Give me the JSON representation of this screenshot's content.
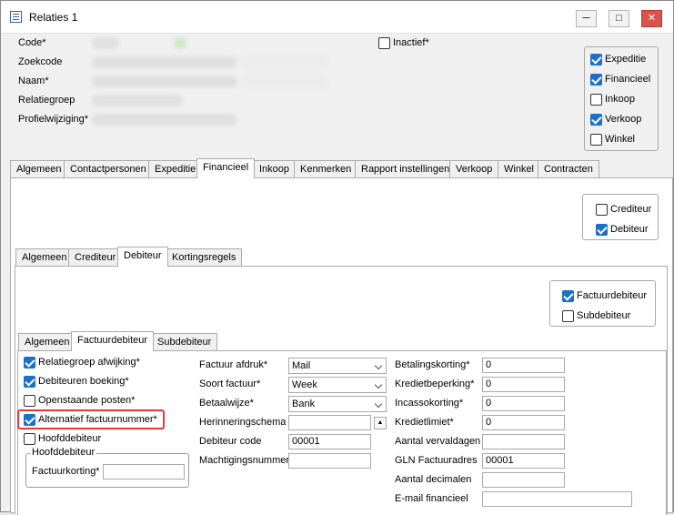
{
  "window": {
    "title": "Relaties 1",
    "minimize": "─",
    "maximize": "□",
    "close": "✕"
  },
  "header": {
    "code_label": "Code*",
    "zoekcode_label": "Zoekcode",
    "naam_label": "Naam*",
    "relatiegroep_label": "Relatiegroep",
    "profielwijziging_label": "Profielwijziging*",
    "inactief_label": "Inactief*",
    "inactief_checked": false
  },
  "roles": [
    {
      "label": "Expeditie",
      "checked": true
    },
    {
      "label": "Financieel",
      "checked": true
    },
    {
      "label": "Inkoop",
      "checked": false
    },
    {
      "label": "Verkoop",
      "checked": true
    },
    {
      "label": "Winkel",
      "checked": false
    }
  ],
  "main_tabs": [
    "Algemeen",
    "Contactpersonen",
    "Expeditie",
    "Financieel",
    "Inkoop",
    "Kenmerken",
    "Rapport instellingen",
    "Verkoop",
    "Winkel",
    "Contracten"
  ],
  "main_active": "Financieel",
  "fin_roles": [
    {
      "label": "Crediteur",
      "checked": false
    },
    {
      "label": "Debiteur",
      "checked": true
    }
  ],
  "fin_tabs": [
    "Algemeen",
    "Crediteur",
    "Debiteur",
    "Kortingsregels"
  ],
  "fin_active": "Debiteur",
  "deb_roles": [
    {
      "label": "Factuurdebiteur",
      "checked": true
    },
    {
      "label": "Subdebiteur",
      "checked": false
    }
  ],
  "deb_tabs": [
    "Algemeen",
    "Factuurdebiteur",
    "Subdebiteur"
  ],
  "deb_active": "Factuurdebiteur",
  "options": [
    {
      "label": "Relatiegroep afwijking*",
      "checked": true
    },
    {
      "label": "Debiteuren boeking*",
      "checked": true
    },
    {
      "label": "Openstaande posten*",
      "checked": false
    },
    {
      "label": "Alternatief factuurnummer*",
      "checked": true
    },
    {
      "label": "Hoofddebiteur",
      "checked": false
    }
  ],
  "hoofddebiteur_group": {
    "legend": "Hoofddebiteur",
    "field_label": "Factuurkorting*",
    "value": ""
  },
  "middle": {
    "factuur_afdruk": {
      "label": "Factuur afdruk*",
      "value": "Mail"
    },
    "soort_factuur": {
      "label": "Soort factuur*",
      "value": "Week"
    },
    "betaalwijze": {
      "label": "Betaalwijze*",
      "value": "Bank"
    },
    "herinneringsschema": {
      "label": "Herinneringschema",
      "value": "",
      "button": "▲"
    },
    "debiteur_code": {
      "label": "Debiteur code",
      "value": "00001"
    },
    "machtigingsnummer": {
      "label": "Machtigingsnummer",
      "value": ""
    }
  },
  "right": {
    "betalingskorting": {
      "label": "Betalingskorting*",
      "value": "0"
    },
    "kredietbeperking": {
      "label": "Kredietbeperking*",
      "value": "0"
    },
    "incassokorting": {
      "label": "Incassokorting*",
      "value": "0"
    },
    "kredietlimiet": {
      "label": "Kredietlimiet*",
      "value": "0"
    },
    "aantal_vervaldagen": {
      "label": "Aantal vervaldagen",
      "value": ""
    },
    "gln": {
      "label": "GLN Factuuradres",
      "value": "00001"
    },
    "aantal_decimalen": {
      "label": "Aantal decimalen",
      "value": ""
    },
    "email": {
      "label": "E-mail financieel",
      "value": ""
    }
  }
}
